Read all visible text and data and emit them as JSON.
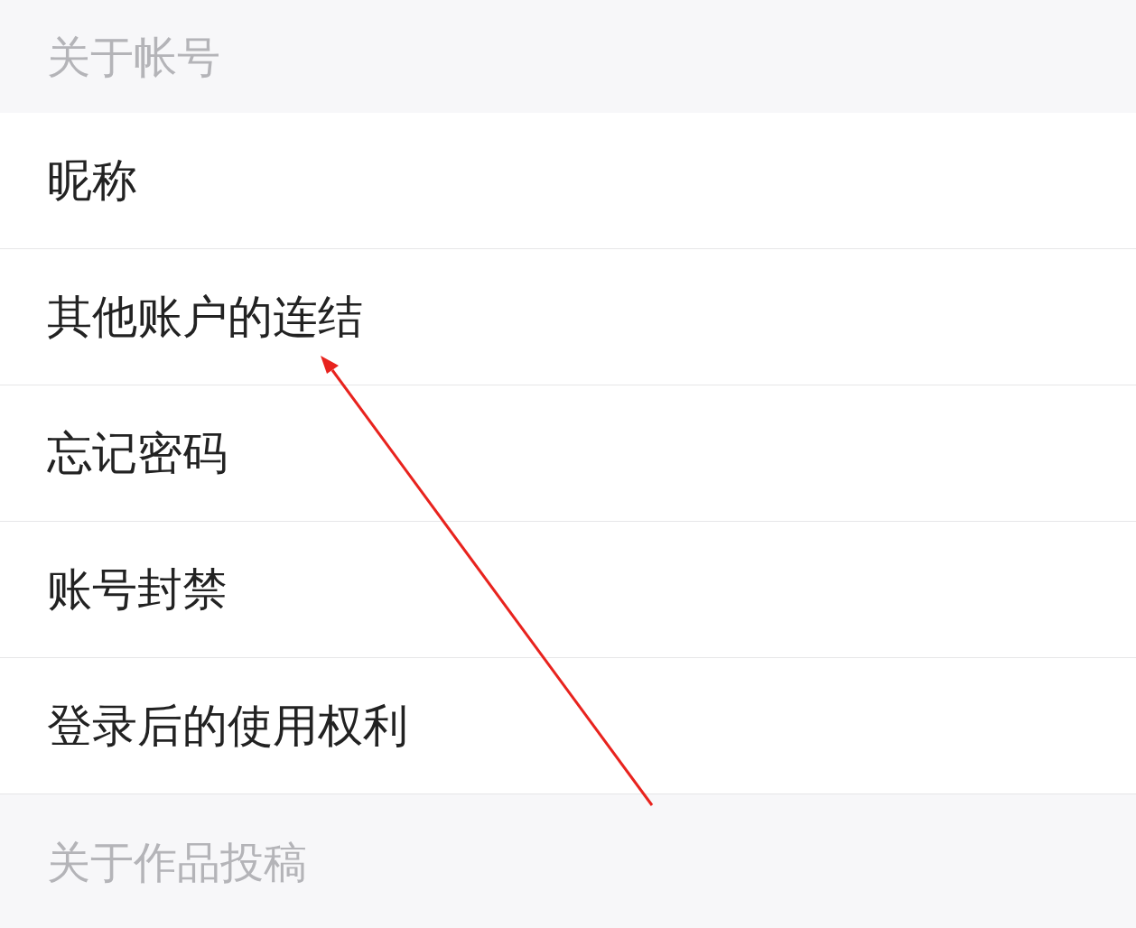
{
  "sections": [
    {
      "title": "关于帐号",
      "items": [
        {
          "label": "昵称"
        },
        {
          "label": "其他账户的连结"
        },
        {
          "label": "忘记密码"
        },
        {
          "label": "账号封禁"
        },
        {
          "label": "登录后的使用权利"
        }
      ]
    },
    {
      "title": "关于作品投稿"
    }
  ]
}
